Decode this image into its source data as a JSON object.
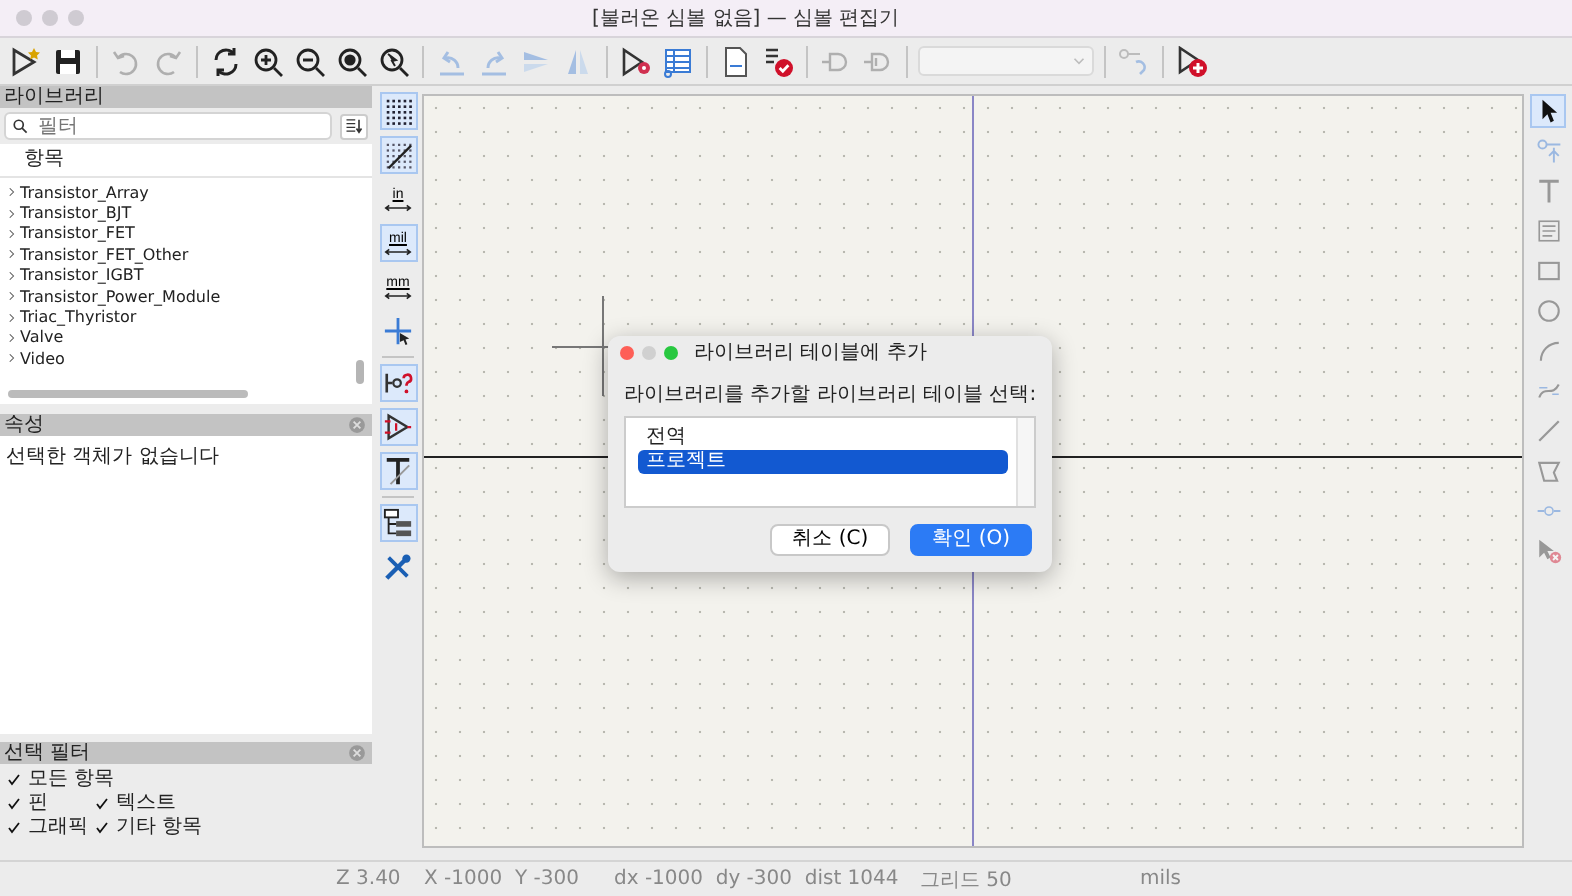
{
  "window": {
    "title": "[불러온 심볼 없음] — 심볼 편집기"
  },
  "toolbar": [
    {
      "kind": "button",
      "disabled": false
    },
    {
      "kind": "button",
      "disabled": false
    },
    {
      "kind": "separator"
    },
    {
      "kind": "button",
      "disabled": true
    },
    {
      "kind": "button",
      "disabled": true
    },
    {
      "kind": "separator"
    },
    {
      "kind": "button",
      "disabled": false
    },
    {
      "kind": "button",
      "disabled": false
    },
    {
      "kind": "button",
      "disabled": false
    },
    {
      "kind": "button",
      "disabled": false
    },
    {
      "kind": "button",
      "disabled": false
    },
    {
      "kind": "separator"
    },
    {
      "kind": "button",
      "disabled": true
    },
    {
      "kind": "button",
      "disabled": true
    },
    {
      "kind": "button",
      "disabled": true
    },
    {
      "kind": "button",
      "disabled": true
    },
    {
      "kind": "separator"
    },
    {
      "kind": "button",
      "disabled": false
    },
    {
      "kind": "button",
      "disabled": false
    },
    {
      "kind": "separator"
    },
    {
      "kind": "button",
      "disabled": false
    },
    {
      "kind": "button",
      "disabled": false
    },
    {
      "kind": "separator"
    },
    {
      "kind": "button",
      "disabled": true
    },
    {
      "kind": "button",
      "disabled": true
    },
    {
      "kind": "separator"
    },
    {
      "kind": "dropdown",
      "disabled": true
    },
    {
      "kind": "separator"
    },
    {
      "kind": "button",
      "disabled": true
    },
    {
      "kind": "separator"
    },
    {
      "kind": "button",
      "disabled": false
    }
  ],
  "library_panel": {
    "title": "라이브러리",
    "filter": {
      "placeholder": "필터"
    },
    "column": "항목",
    "items": [
      {
        "label": "Transistor_Array",
        "expanded": false
      },
      {
        "label": "Transistor_BJT",
        "expanded": false
      },
      {
        "label": "Transistor_FET",
        "expanded": false
      },
      {
        "label": "Transistor_FET_Other",
        "expanded": false
      },
      {
        "label": "Transistor_IGBT",
        "expanded": false
      },
      {
        "label": "Transistor_Power_Module",
        "expanded": false
      },
      {
        "label": "Triac_Thyristor",
        "expanded": false
      },
      {
        "label": "Valve",
        "expanded": false
      },
      {
        "label": "Video",
        "expanded": false
      }
    ]
  },
  "properties_panel": {
    "title": "속성",
    "message": "선택한 객체가 없습니다"
  },
  "selection_filter": {
    "title": "선택 필터",
    "options": [
      {
        "label": "모든 항목",
        "checked": true
      },
      {
        "label": "핀",
        "checked": true
      },
      {
        "label": "텍스트",
        "checked": true
      },
      {
        "label": "그래픽",
        "checked": true
      },
      {
        "label": "기타 항목",
        "checked": true
      }
    ]
  },
  "left_toolbar": [
    {
      "kind": "icon",
      "selected": true
    },
    {
      "kind": "icon",
      "selected": true
    },
    {
      "kind": "unit",
      "label": "in",
      "selected": false
    },
    {
      "kind": "unit",
      "label": "mil",
      "selected": true
    },
    {
      "kind": "unit",
      "label": "mm",
      "selected": false
    },
    {
      "kind": "icon",
      "selected": false
    },
    {
      "kind": "separator"
    },
    {
      "kind": "icon",
      "selected": true
    },
    {
      "kind": "icon",
      "selected": true
    },
    {
      "kind": "icon",
      "selected": true
    },
    {
      "kind": "separator"
    },
    {
      "kind": "icon",
      "selected": true
    },
    {
      "kind": "icon",
      "selected": false
    }
  ],
  "right_toolbar": [
    {
      "selected": true,
      "disabled": false
    },
    {
      "selected": false,
      "disabled": true
    },
    {
      "selected": false,
      "disabled": true
    },
    {
      "selected": false,
      "disabled": true
    },
    {
      "selected": false,
      "disabled": true
    },
    {
      "selected": false,
      "disabled": true
    },
    {
      "selected": false,
      "disabled": true
    },
    {
      "selected": false,
      "disabled": true
    },
    {
      "selected": false,
      "disabled": true
    },
    {
      "selected": false,
      "disabled": true
    },
    {
      "selected": false,
      "disabled": true
    },
    {
      "selected": false,
      "disabled": true
    }
  ],
  "dialog": {
    "title": "라이브러리 테이블에 추가",
    "prompt": "라이브러리를 추가할 라이브러리 테이블 선택:",
    "options": [
      {
        "label": "전역",
        "selected": false
      },
      {
        "label": "프로젝트",
        "selected": true
      }
    ],
    "buttons": [
      {
        "label": "취소 (C)",
        "primary": false
      },
      {
        "label": "확인 (O)",
        "primary": true
      }
    ]
  },
  "status_bar": [
    "Z 3.40",
    "X -1000  Y -300",
    "dx -1000  dy -300  dist 1044",
    "그리드 50",
    "mils"
  ]
}
